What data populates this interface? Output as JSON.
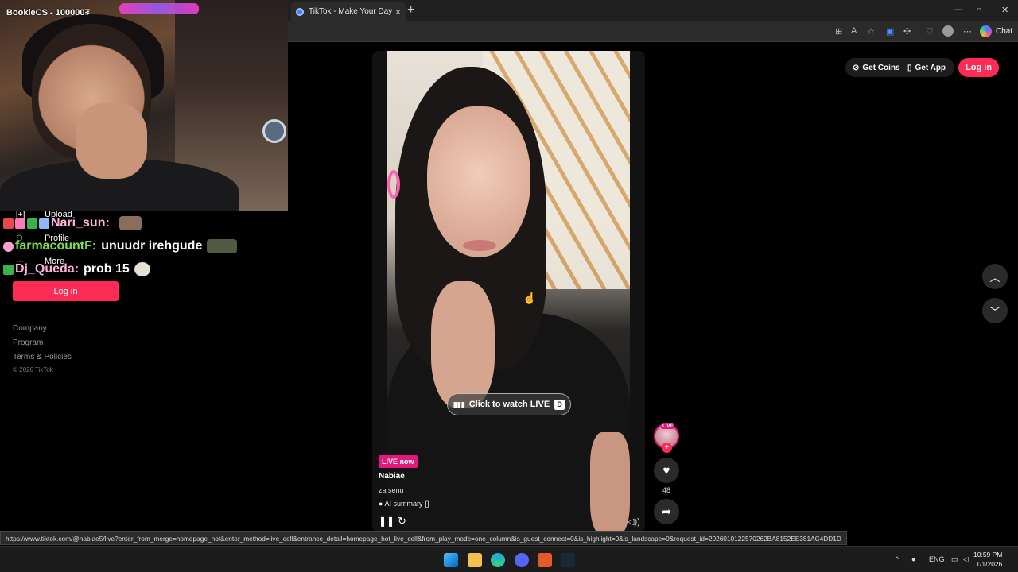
{
  "stream": {
    "overlay_label": "BookieCS - 100000₮"
  },
  "browser": {
    "tab_title": "TikTok - Make Your Day",
    "tab_close": "×",
    "new_tab": "+",
    "window_minimize": "—",
    "window_restore": "▫",
    "window_close": "✕",
    "chat_label": "Chat",
    "status_url": "https://www.tiktok.com/@nabiae5/live?enter_from_merge=homepage_hot&enter_method=live_cell&entrance_detail=homepage_hot_live_cell&from_play_mode=one_column&is_guest_connect=0&is_highlight=0&is_landscape=0&request_id=2026010122570262BA8152EE381AC4DD1D"
  },
  "sidebar": {
    "items": [
      {
        "icon": "[+]",
        "label": "Upload"
      },
      {
        "icon": "⚇",
        "label": "Profile"
      },
      {
        "icon": "⋯",
        "label": "More"
      }
    ],
    "login_label": "Log in",
    "footer_links": [
      "Company",
      "Program",
      "Terms & Policies"
    ],
    "copyright": "© 2026 TikTok"
  },
  "chat": [
    {
      "user": "Nari_sun:",
      "message": "",
      "user_color": "#ffb3d9"
    },
    {
      "user": "farmacountF:",
      "message": "unuudr irehgude",
      "user_color": "#7fe04a"
    },
    {
      "user": "Dj_Queda:",
      "message": "prob 15",
      "user_color": "#ffb3d9"
    }
  ],
  "header": {
    "get_coins": "Get Coins",
    "get_app": "Get App",
    "login": "Log in"
  },
  "video": {
    "watch_live": "Click to watch LIVE",
    "watch_live_key": "D",
    "live_badge": "LIVE now",
    "author": "Nabiae",
    "description": "za senu",
    "ai_summary": "AI summary",
    "ai_summary_tag": "{}",
    "likes": "48",
    "avatar_live": "LIVE"
  },
  "taskbar": {
    "language": "ENG",
    "time": "10:59 PM",
    "date": "1/1/2026"
  },
  "colors": {
    "brand": "#fe2c55",
    "live": "#e0197d"
  }
}
